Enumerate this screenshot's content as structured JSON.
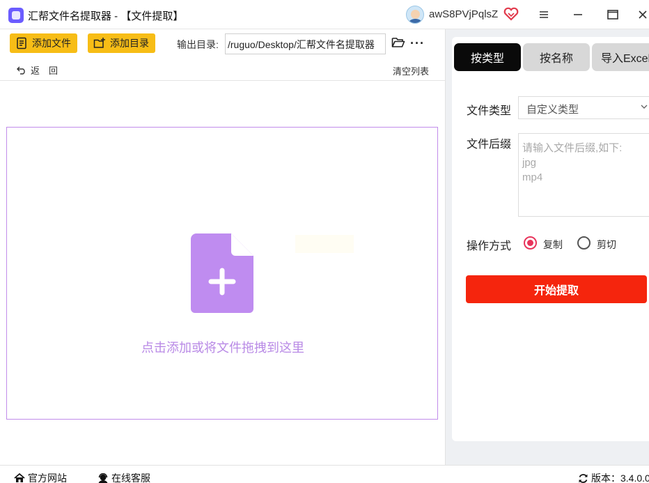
{
  "window": {
    "title": "汇帮文件名提取器 - 【文件提取】",
    "username": "awS8PVjPqlsZ"
  },
  "toolbar": {
    "add_file_label": "添加文件",
    "add_dir_label": "添加目录",
    "output_dir_label": "输出目录:",
    "output_dir_value": "/ruguo/Desktop/汇帮文件名提取器",
    "back_label": "返　回",
    "clear_label": "清空列表"
  },
  "dropzone": {
    "hint": "点击添加或将文件拖拽到这里"
  },
  "right_panel": {
    "tabs": [
      {
        "label": "按类型",
        "active": true
      },
      {
        "label": "按名称",
        "active": false
      },
      {
        "label": "导入Excel",
        "active": false
      }
    ],
    "file_type_label": "文件类型",
    "file_type_value": "自定义类型",
    "ext_label": "文件后缀",
    "ext_placeholder": "请输入文件后缀,如下:\njpg\nmp4",
    "operation_label": "操作方式",
    "operation_options": [
      {
        "label": "复制",
        "selected": true
      },
      {
        "label": "剪切",
        "selected": false
      }
    ],
    "start_label": "开始提取"
  },
  "status_bar": {
    "website_label": "官方网站",
    "support_label": "在线客服",
    "version_label": "版本：3.4.0.0"
  },
  "colors": {
    "accent_yellow": "#f7bd16",
    "drop_purple": "#c18cea",
    "start_red": "#f5250d",
    "radio_red": "#e8345b"
  }
}
